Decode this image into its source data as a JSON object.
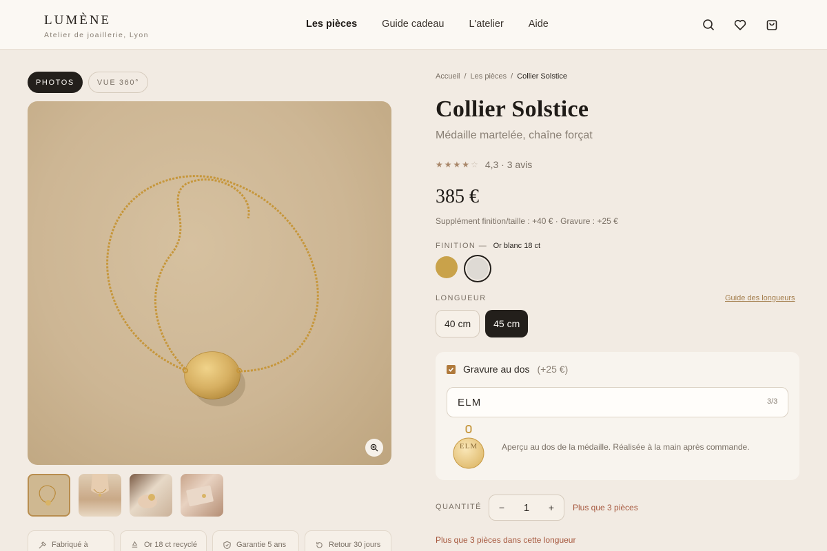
{
  "brand": {
    "name": "LUMÈNE",
    "tagline": "Atelier de joaillerie, Lyon"
  },
  "nav": [
    "Les pièces",
    "Guide cadeau",
    "L'atelier",
    "Aide"
  ],
  "header_icons": [
    "search-icon",
    "heart-icon",
    "bag-icon"
  ],
  "gallery": {
    "tabs": [
      "PHOTOS",
      "VUE 360°"
    ],
    "active_tab": "PHOTOS",
    "thumbnails": [
      "necklace-flatlay",
      "model-wearing",
      "hand-holding",
      "gift-box"
    ],
    "selected_thumbnail": 0
  },
  "badges": [
    "Fabriqué à",
    "Or 18 ct recyclé",
    "Garantie 5 ans",
    "Retour 30 jours"
  ],
  "breadcrumb": [
    "Accueil",
    "Les pièces",
    "Collier Solstice"
  ],
  "product": {
    "title": "Collier Solstice",
    "subtitle": "Médaille martelée, chaîne forçat",
    "rating_value": 4.3,
    "rating_text": "4,3 · 3 avis",
    "price": "385 €",
    "price_note": "Supplément finition/taille : +40 € · Gravure : +25 €"
  },
  "finish": {
    "label": "FINITION —",
    "selected": "Or blanc 18 ct",
    "options": [
      {
        "name": "Or jaune",
        "color": "#c9a24a"
      },
      {
        "name": "Or blanc 18 ct",
        "color": "#dedad4"
      }
    ]
  },
  "length": {
    "label": "LONGUEUR",
    "guide_link": "Guide des longueurs",
    "options": [
      "40 cm",
      "45 cm"
    ],
    "selected": "45 cm"
  },
  "engraving": {
    "checked": true,
    "label": "Gravure au dos",
    "extra": "(+25 €)",
    "value": "ELM",
    "count": "3/3",
    "preview_text": "ELM",
    "note": "Aperçu au dos de la médaille. Réalisée à la main après commande."
  },
  "quantity": {
    "label": "QUANTITÉ",
    "minus": "−",
    "value": "1",
    "plus": "+",
    "stock_inline": "Plus que 3 pièces",
    "stock_line": "Plus que 3 pièces dans cette longueur"
  },
  "colors": {
    "accent": "#b07a3c",
    "dark": "#231f1b",
    "background": "#f2ebe3",
    "warning": "#a5563c"
  }
}
